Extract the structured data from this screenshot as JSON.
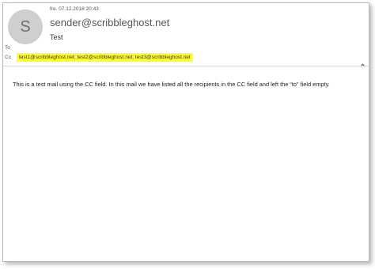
{
  "message": {
    "sender_initial": "S",
    "date": "fre. 07.12.2018 20:43",
    "sender": "sender@scribbleghost.net",
    "subject": "Test",
    "to_label": "To",
    "cc_label": "Cc",
    "cc_recipients": "test1@scribbleghost.net; test2@scribbleghost.net; test3@scribbleghost.net",
    "body": "This is a test mail using the CC field. In this mail we have listed all the recipients in the CC field and left the “to” field empty."
  },
  "icons": {
    "collapse": "chevron-up-icon"
  },
  "colors": {
    "highlight": "#ffff2e",
    "avatar_bg": "#cfcfcf"
  }
}
